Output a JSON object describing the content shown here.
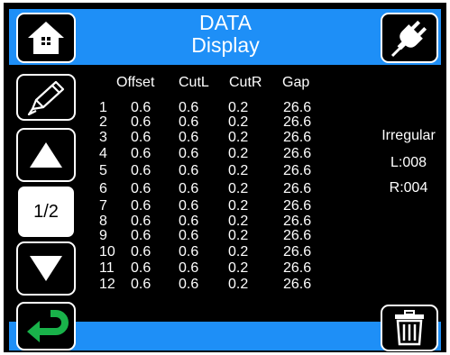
{
  "header": {
    "title_line1": "DATA",
    "title_line2": "Display"
  },
  "pager": {
    "current": "1/2"
  },
  "table": {
    "columns": [
      "Offset",
      "CutL",
      "CutR",
      "Gap"
    ],
    "rows": [
      [
        "1",
        "0.6",
        "0.6",
        "0.2",
        "26.6"
      ],
      [
        "2",
        "0.6",
        "0.6",
        "0.2",
        "26.6"
      ],
      [
        "3",
        "0.6",
        "0.6",
        "0.2",
        "26.6"
      ],
      [
        "4",
        "0.6",
        "0.6",
        "0.2",
        "26.6"
      ],
      [
        "5",
        "0.6",
        "0.6",
        "0.2",
        "26.6"
      ],
      [
        "6",
        "0.6",
        "0.6",
        "0.2",
        "26.6"
      ],
      [
        "7",
        "0.6",
        "0.6",
        "0.2",
        "26.6"
      ],
      [
        "8",
        "0.6",
        "0.6",
        "0.2",
        "26.6"
      ],
      [
        "9",
        "0.6",
        "0.6",
        "0.2",
        "26.6"
      ],
      [
        "10",
        "0.6",
        "0.6",
        "0.2",
        "26.6"
      ],
      [
        "11",
        "0.6",
        "0.6",
        "0.2",
        "26.6"
      ],
      [
        "12",
        "0.6",
        "0.6",
        "0.2",
        "26.6"
      ]
    ]
  },
  "status": {
    "type": "Irregular",
    "left": "L:008",
    "right": "R:004"
  },
  "icons": {
    "home": "home-icon",
    "pencil": "pencil-icon",
    "up": "arrow-up-icon",
    "down": "arrow-down-icon",
    "back": "return-icon",
    "plug": "plug-icon",
    "trash": "trash-icon"
  },
  "colors": {
    "accent": "#1e8ff7",
    "return_green": "#19b24a",
    "background": "#000000"
  }
}
